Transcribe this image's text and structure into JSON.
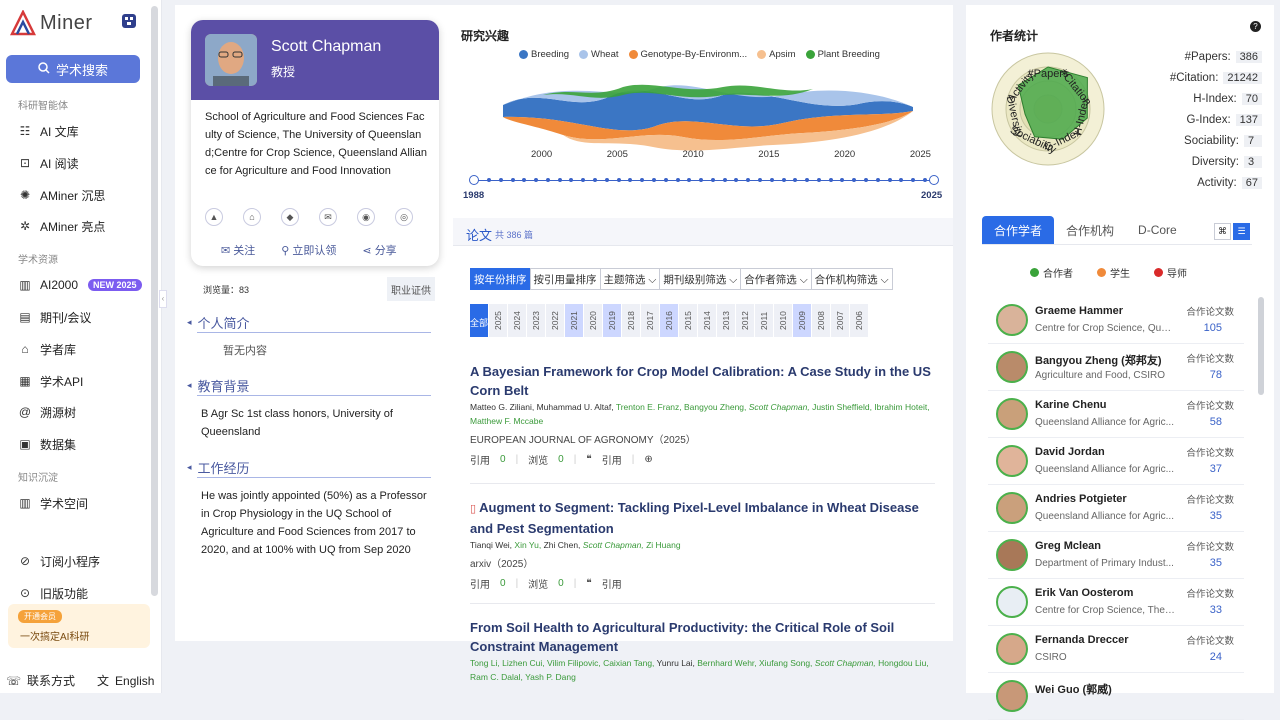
{
  "sidebar": {
    "logo_text": "Miner",
    "search_label": "学术搜索",
    "section1": "科研智能体",
    "items1": [
      {
        "label": "AI 文库",
        "icon": "book-icon"
      },
      {
        "label": "AI 阅读",
        "icon": "read-icon"
      },
      {
        "label": "AMiner 沉思",
        "icon": "think-icon"
      },
      {
        "label": "AMiner 亮点",
        "icon": "highlight-icon"
      }
    ],
    "section2": "学术资源",
    "items2": [
      {
        "label": "AI2000",
        "icon": "chart-icon"
      },
      {
        "label": "期刊/会议",
        "icon": "journal-icon"
      },
      {
        "label": "学者库",
        "icon": "scholar-icon"
      },
      {
        "label": "学术API",
        "icon": "api-icon"
      },
      {
        "label": "溯源树",
        "icon": "tree-icon"
      },
      {
        "label": "数据集",
        "icon": "dataset-icon"
      }
    ],
    "new_badge": "NEW 2025",
    "section3": "知识沉淀",
    "items3": [
      {
        "label": "学术空间",
        "icon": "space-icon"
      }
    ],
    "items4": [
      {
        "label": "订阅小程序",
        "icon": "subscribe-icon"
      },
      {
        "label": "旧版功能",
        "icon": "legacy-icon"
      }
    ],
    "promo_pill": "开通会员",
    "promo_text": "一次搞定AI科研",
    "contact": "联系方式",
    "language": "English"
  },
  "profile": {
    "name": "Scott Chapman",
    "title": "教授",
    "affiliation": "School of Agriculture and Food Sciences Faculty of Science, The University of Queensland;Centre for Crop Science, Queensland Alliance for Agriculture and Food Innovation",
    "follow": "关注",
    "claim": "立即认领",
    "share": "分享",
    "views_label": "浏览量：83",
    "career_tag": "职业证供",
    "bio_title": "个人简介",
    "bio": "暂无内容",
    "edu_title": "教育背景",
    "edu": "B Agr Sc 1st class honors, University of Queensland",
    "work_title": "工作经历",
    "work": "He was jointly appointed (50%) as a Professor in Crop Physiology in the UQ School of Agriculture and Food Sciences from 2017 to 2020, and at 100% with UQ from Sep 2020"
  },
  "interests": {
    "title": "研究兴趣",
    "legend": [
      {
        "name": "Breeding",
        "color": "#3b76c4"
      },
      {
        "name": "Wheat",
        "color": "#a9c4ea"
      },
      {
        "name": "Genotype-By-Environm...",
        "color": "#f08a3a"
      },
      {
        "name": "Apsim",
        "color": "#f6c08f"
      },
      {
        "name": "Plant Breeding",
        "color": "#3aa33a"
      }
    ],
    "axis": [
      "2000",
      "2005",
      "2010",
      "2015",
      "2020",
      "2025"
    ],
    "range_start": "1988",
    "range_end": "2025"
  },
  "papers": {
    "title": "论文",
    "count": "共 386 篇",
    "filters": [
      "按年份排序",
      "按引用量排序",
      "主题筛选 ⌵",
      "期刊级别筛选 ⌵",
      "合作者筛选 ⌵",
      "合作机构筛选 ⌵"
    ],
    "all": "全部",
    "years": [
      "2025",
      "2024",
      "2023",
      "2022",
      "2021",
      "2020",
      "2019",
      "2018",
      "2017",
      "2016",
      "2015",
      "2014",
      "2013",
      "2012",
      "2011",
      "2010",
      "2009",
      "2008",
      "2007",
      "2006"
    ],
    "cite_label": "引用",
    "view_label": "浏览",
    "list": [
      {
        "title": "A Bayesian Framework for Crop Model Calibration: A Case Study in the US Corn Belt",
        "authors_plain": "Matteo G. Ziliani,  Muhammad U. Altaf, ",
        "authors_green": "Trenton E. Franz,  Bangyou Zheng,  ",
        "authors_me": "Scott Chapman,",
        "authors_green2": "  Justin Sheffield,  Ibrahim Hoteit,  Matthew F. Mccabe",
        "venue": "EUROPEAN JOURNAL OF AGRONOMY（2025）",
        "cites": "0",
        "views": "0"
      },
      {
        "title": "Augment to Segment: Tackling Pixel-Level Imbalance in Wheat Disease and Pest Segmentation",
        "authors_plain": "Tianqi Wei, ",
        "authors_green": "Xin Yu, ",
        "authors_plain2": " Zhi Chen, ",
        "authors_me": "Scott Chapman,",
        "authors_green2": "  Zi Huang",
        "venue": "arxiv（2025）",
        "cites": "0",
        "views": "0"
      },
      {
        "title": "From Soil Health to Agricultural Productivity: the Critical Role of Soil Constraint Management",
        "authors_plain": "",
        "authors_green": "Tong Li,  Lizhen Cui,  Vilim Filipovic,  Caixian Tang,  ",
        "authors_plain2": "Yunru Lai,  ",
        "authors_green2": "Bernhard Wehr,  Xiufang Song,  ",
        "authors_me": "Scott Chapman,",
        "authors_green3": "  Hongdou Liu,  Ram C. Dalal,  Yash P. Dang"
      }
    ]
  },
  "stats": {
    "title": "作者统计",
    "items": [
      {
        "k": "#Papers:",
        "v": "386"
      },
      {
        "k": "#Citation:",
        "v": "21242"
      },
      {
        "k": "H-Index:",
        "v": "70"
      },
      {
        "k": "G-Index:",
        "v": "137"
      },
      {
        "k": "Sociability:",
        "v": "7"
      },
      {
        "k": "Diversity:",
        "v": "3"
      },
      {
        "k": "Activity:",
        "v": "67"
      }
    ],
    "radar_labels": [
      "#Papers",
      "#Citation",
      "H-Index",
      "G-Index",
      "Sociability",
      "Diversity",
      "Activity"
    ],
    "radar_values": [
      0.75,
      0.9,
      0.72,
      0.6,
      0.55,
      0.42,
      0.68
    ]
  },
  "coauthors": {
    "tabs": [
      "合作学者",
      "合作机构",
      "D-Core"
    ],
    "legend": [
      {
        "name": "合作者",
        "color": "#3aa33a"
      },
      {
        "name": "学生",
        "color": "#f08a3a"
      },
      {
        "name": "导师",
        "color": "#d92a2a"
      }
    ],
    "count_label": "合作论文数",
    "list": [
      {
        "name": "Graeme Hammer",
        "org": "Centre for Crop Science, Que...",
        "count": "105"
      },
      {
        "name": "Bangyou Zheng (郑邦友)",
        "org": "Agriculture and Food, CSIRO",
        "count": "78"
      },
      {
        "name": "Karine Chenu",
        "org": "Queensland Alliance for Agric...",
        "count": "58"
      },
      {
        "name": "David Jordan",
        "org": "Queensland Alliance for Agric...",
        "count": "37"
      },
      {
        "name": "Andries Potgieter",
        "org": "Queensland Alliance for Agric...",
        "count": "35"
      },
      {
        "name": "Greg Mclean",
        "org": "Department of Primary Indust...",
        "count": "35"
      },
      {
        "name": "Erik Van Oosterom",
        "org": "Centre for Crop Science, The ...",
        "count": "33"
      },
      {
        "name": "Fernanda Dreccer",
        "org": "CSIRO",
        "count": "24"
      },
      {
        "name": "Wei Guo (郭威)",
        "org": "",
        "count": ""
      }
    ]
  }
}
